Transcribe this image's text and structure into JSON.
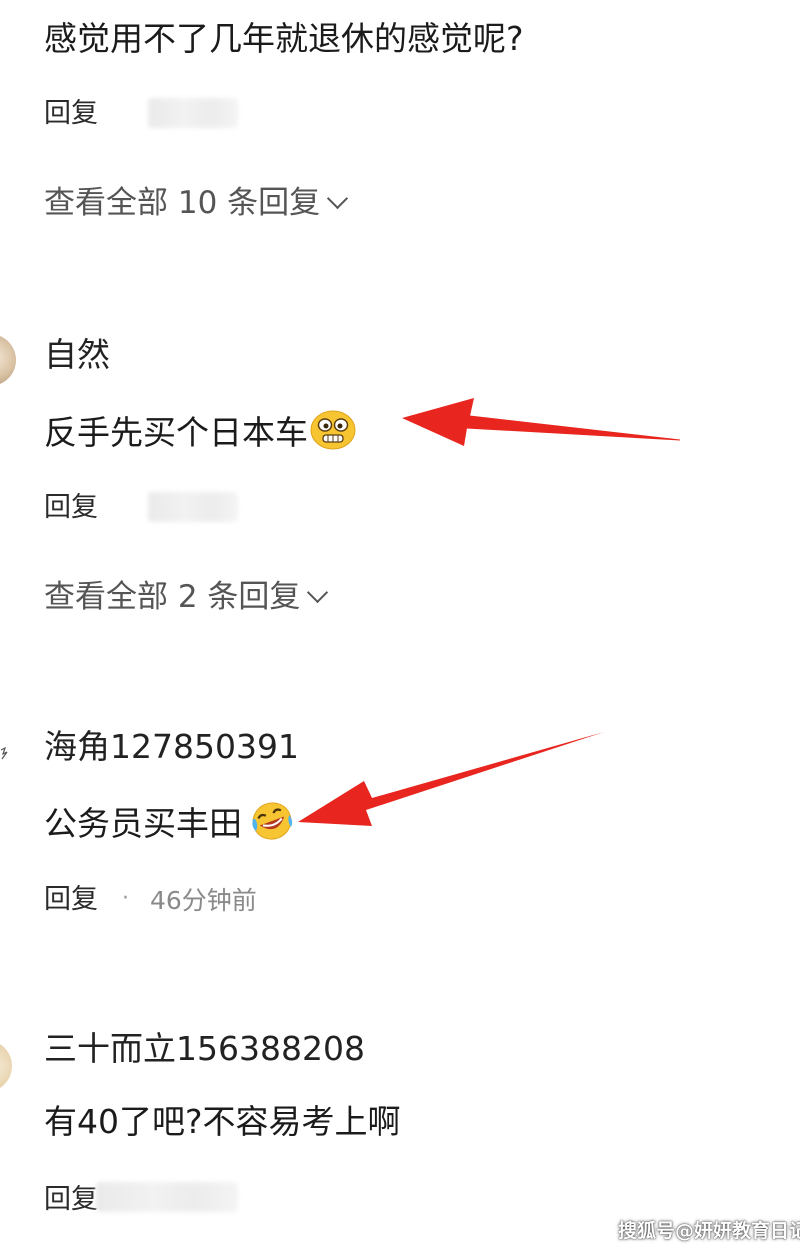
{
  "comments": [
    {
      "content": "感觉用不了几年就退休的感觉呢?",
      "reply_label": "回复",
      "view_all_replies": "查看全部 10 条回复"
    },
    {
      "username": "自然",
      "content": "反手先买个日本车",
      "emoji": "grimace-face-emoji",
      "reply_label": "回复",
      "view_all_replies": "查看全部 2 条回复"
    },
    {
      "username": "海角127850391",
      "content": "公务员买丰田",
      "emoji": "rolling-laughing-face-emoji",
      "reply_label": "回复",
      "separator": "·",
      "timestamp": "46分钟前"
    },
    {
      "username": "三十而立156388208",
      "content": "有40了吧?不容易考上啊",
      "reply_label": "回复"
    }
  ],
  "watermark": "搜狐号@妍妍教育日记",
  "annotation_color": "#e8261f"
}
